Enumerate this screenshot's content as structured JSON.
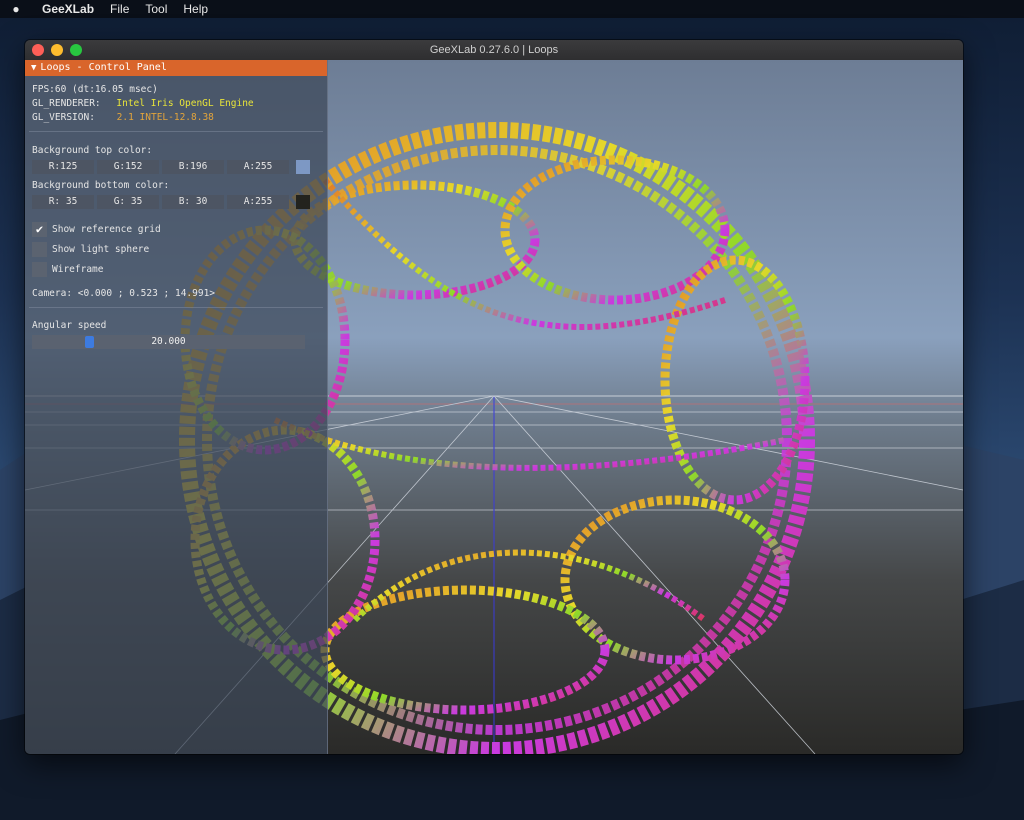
{
  "menubar": {
    "app_name": "GeeXLab",
    "items": [
      "File",
      "Tool",
      "Help"
    ]
  },
  "window": {
    "title": "GeeXLab 0.27.6.0 | Loops"
  },
  "panel": {
    "header": "Loops - Control Panel",
    "fps": "FPS:60 (dt:16.05 msec)",
    "renderer_label": "GL_RENDERER:",
    "renderer_value": "Intel Iris OpenGL Engine",
    "version_label": "GL_VERSION:",
    "version_value": "2.1 INTEL-12.8.38",
    "bg_top_label": "Background top color:",
    "bg_top": {
      "r": "R:125",
      "g": "G:152",
      "b": "B:196",
      "a": "A:255",
      "swatch": "#7d98c4"
    },
    "bg_bottom_label": "Background bottom color:",
    "bg_bottom": {
      "r": "R: 35",
      "g": "G: 35",
      "b": "B: 30",
      "a": "A:255",
      "swatch": "#23231e"
    },
    "checkboxes": [
      {
        "label": "Show reference grid",
        "checked": true,
        "mark": "✔"
      },
      {
        "label": "Show light sphere",
        "checked": false,
        "mark": ""
      },
      {
        "label": "Wireframe",
        "checked": false,
        "mark": ""
      }
    ],
    "camera": "Camera: <0.000 ; 0.523 ; 14.991>",
    "angular_speed_label": "Angular speed",
    "angular_speed_value": "20.000",
    "angular_speed_fraction": 0.2
  }
}
